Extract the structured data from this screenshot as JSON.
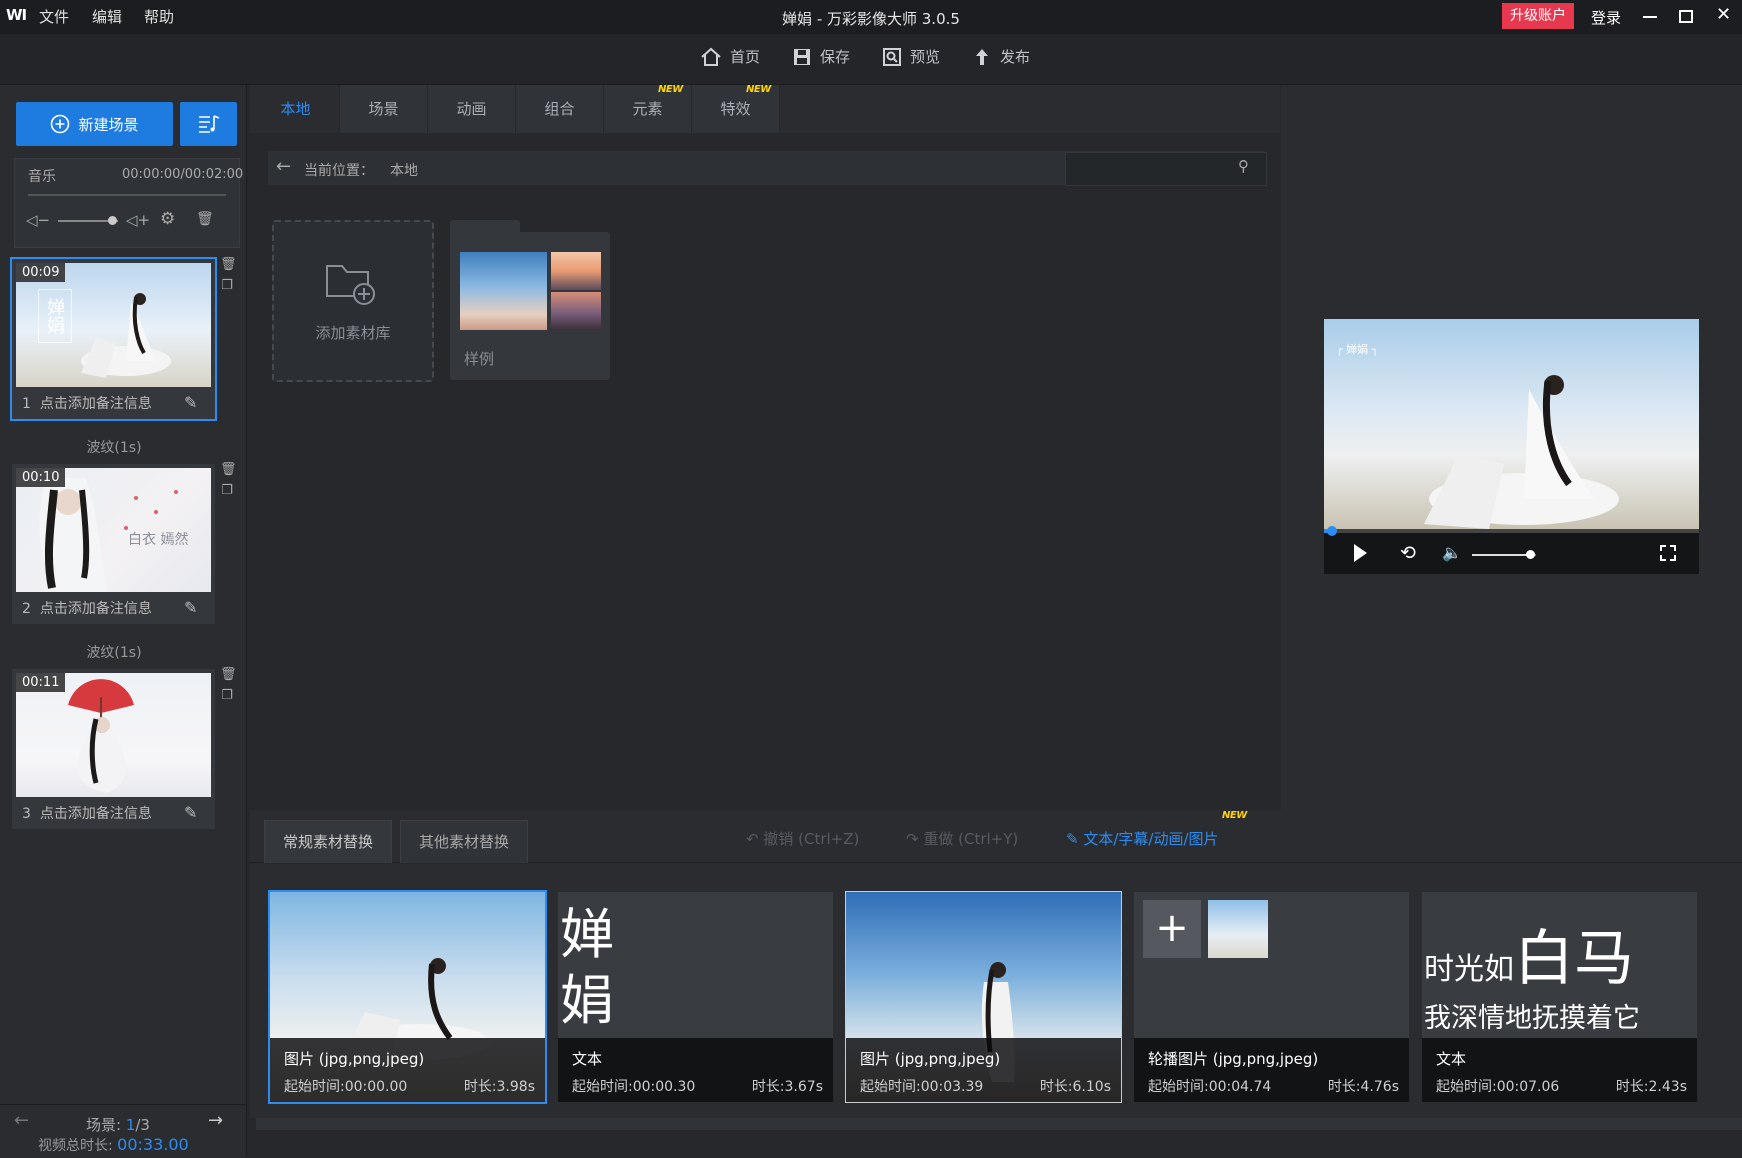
{
  "window": {
    "title": "婵娟 - 万彩影像大师 3.0.5",
    "logo": "WI",
    "menu": [
      "文件",
      "编辑",
      "帮助"
    ],
    "upgrade_label": "升级账户",
    "login_label": "登录"
  },
  "toolbar": {
    "home": "首页",
    "save": "保存",
    "preview": "预览",
    "publish": "发布"
  },
  "left": {
    "new_scene": "新建场景",
    "music_label": "音乐",
    "music_time": "00:00:00/00:02:00",
    "music_volume": 0.8,
    "scenes": [
      {
        "time": "00:09",
        "index": "1",
        "note": "点击添加备注信息",
        "overlay_text": "婵娟"
      },
      {
        "time": "00:10",
        "index": "2",
        "note": "点击添加备注信息",
        "overlay_text": "白衣 嫣然"
      },
      {
        "time": "00:11",
        "index": "3",
        "note": "点击添加备注信息",
        "overlay_text": ""
      }
    ],
    "transitions": [
      "波纹(1s)",
      "波纹(1s)"
    ],
    "scene_label": "场景: ",
    "scene_current": "1",
    "scene_total": "/3",
    "total_duration_label": "视频总时长: ",
    "total_duration": "00:33.00"
  },
  "library": {
    "tabs": [
      {
        "label": "本地",
        "active": true,
        "new": false
      },
      {
        "label": "场景",
        "active": false,
        "new": false
      },
      {
        "label": "动画",
        "active": false,
        "new": false
      },
      {
        "label": "组合",
        "active": false,
        "new": false
      },
      {
        "label": "元素",
        "active": false,
        "new": true
      },
      {
        "label": "特效",
        "active": false,
        "new": true
      }
    ],
    "new_badge": "NEW",
    "location_label": "当前位置：",
    "location_value": "本地",
    "search_placeholder": "",
    "add_library": "添加素材库",
    "sample": "样例"
  },
  "preview": {
    "progress": 0.02,
    "volume": 0.9,
    "caption": "婵娟"
  },
  "bottom": {
    "tabs": [
      "常规素材替换",
      "其他素材替换"
    ],
    "undo": "撤销 (Ctrl+Z)",
    "redo": "重做 (Ctrl+Y)",
    "text_tool": "文本/字幕/动画/图片",
    "text_tool_new": "NEW",
    "clips": [
      {
        "title": "图片 (jpg,png,jpeg)",
        "start": "起始时间:00:00.00",
        "duration": "时长:3.98s",
        "big": ""
      },
      {
        "title": "文本",
        "start": "起始时间:00:00.30",
        "duration": "时长:3.67s",
        "big": "婵娟"
      },
      {
        "title": "图片 (jpg,png,jpeg)",
        "start": "起始时间:00:03.39",
        "duration": "时长:6.10s",
        "big": ""
      },
      {
        "title": "轮播图片 (jpg,png,jpeg)",
        "start": "起始时间:00:04.74",
        "duration": "时长:4.76s",
        "big": ""
      },
      {
        "title": "文本",
        "start": "起始时间:00:07.06",
        "duration": "时长:2.43s",
        "big_small": "时光如",
        "big_large": "白马",
        "big_line2": "我深情地抚摸着它"
      }
    ]
  },
  "colors": {
    "accent": "#2d8cf0",
    "upgrade": "#e8384f",
    "new_badge": "#ffd400"
  }
}
